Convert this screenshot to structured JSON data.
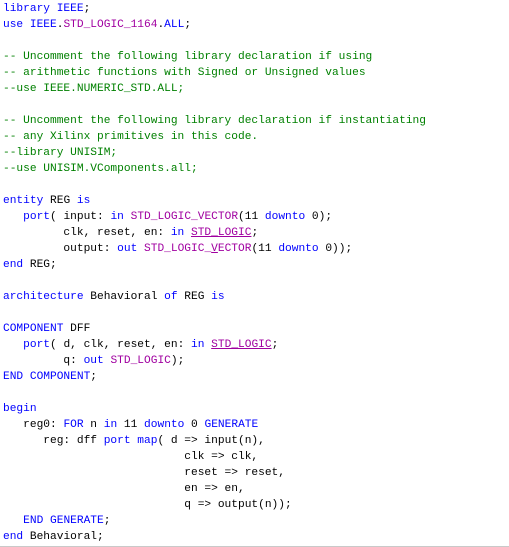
{
  "editor": {
    "colors": {
      "keyword": "#0000ff",
      "comment": "#008000",
      "type": "#a000a0",
      "text": "#000000",
      "background": "#ffffff"
    },
    "lines": [
      [
        [
          "kw",
          "library"
        ],
        [
          "tx",
          " "
        ],
        [
          "kw",
          "IEEE"
        ],
        [
          "tx",
          ";"
        ]
      ],
      [
        [
          "kw",
          "use"
        ],
        [
          "tx",
          " "
        ],
        [
          "kw",
          "IEEE"
        ],
        [
          "tx",
          "."
        ],
        [
          "ty",
          "STD_LOGIC_1164"
        ],
        [
          "tx",
          "."
        ],
        [
          "kw",
          "ALL"
        ],
        [
          "tx",
          ";"
        ]
      ],
      [],
      [
        [
          "cm",
          "-- Uncomment the following library declaration if using"
        ]
      ],
      [
        [
          "cm",
          "-- arithmetic functions with Signed or Unsigned values"
        ]
      ],
      [
        [
          "cm",
          "--use IEEE.NUMERIC_STD.ALL;"
        ]
      ],
      [],
      [
        [
          "cm",
          "-- Uncomment the following library declaration if instantiating"
        ]
      ],
      [
        [
          "cm",
          "-- any Xilinx primitives in this code."
        ]
      ],
      [
        [
          "cm",
          "--library UNISIM;"
        ]
      ],
      [
        [
          "cm",
          "--use UNISIM.VComponents.all;"
        ]
      ],
      [],
      [
        [
          "kw",
          "entity"
        ],
        [
          "tx",
          " REG "
        ],
        [
          "kw",
          "is"
        ]
      ],
      [
        [
          "tx",
          "   "
        ],
        [
          "kw",
          "port"
        ],
        [
          "tx",
          "( input: "
        ],
        [
          "kw",
          "in"
        ],
        [
          "tx",
          " "
        ],
        [
          "ty",
          "STD_LOGIC_VECTOR"
        ],
        [
          "tx",
          "(11 "
        ],
        [
          "kw",
          "downto"
        ],
        [
          "tx",
          " 0);"
        ]
      ],
      [
        [
          "tx",
          "         clk, reset, en: "
        ],
        [
          "kw",
          "in"
        ],
        [
          "tx",
          " "
        ],
        [
          "tyu",
          "STD_LOGIC"
        ],
        [
          "tx",
          ";"
        ]
      ],
      [
        [
          "tx",
          "         output: "
        ],
        [
          "kw",
          "out"
        ],
        [
          "tx",
          " "
        ],
        [
          "ty",
          "STD_LOGIC_"
        ],
        [
          "tyu",
          "V"
        ],
        [
          "ty",
          "ECTOR"
        ],
        [
          "tx",
          "(11 "
        ],
        [
          "kw",
          "downto"
        ],
        [
          "tx",
          " 0));"
        ]
      ],
      [
        [
          "kw",
          "end"
        ],
        [
          "tx",
          " REG;"
        ]
      ],
      [],
      [
        [
          "kw",
          "architecture"
        ],
        [
          "tx",
          " Behavioral "
        ],
        [
          "kw",
          "of"
        ],
        [
          "tx",
          " REG "
        ],
        [
          "kw",
          "is"
        ]
      ],
      [],
      [
        [
          "kw",
          "COMPONENT"
        ],
        [
          "tx",
          " DFF"
        ]
      ],
      [
        [
          "tx",
          "   "
        ],
        [
          "kw",
          "port"
        ],
        [
          "tx",
          "( d, clk, reset, en: "
        ],
        [
          "kw",
          "in"
        ],
        [
          "tx",
          " "
        ],
        [
          "tyu",
          "STD_LOGIC"
        ],
        [
          "tx",
          ";"
        ]
      ],
      [
        [
          "tx",
          "         q: "
        ],
        [
          "kw",
          "out"
        ],
        [
          "tx",
          " "
        ],
        [
          "ty",
          "STD_LOGIC"
        ],
        [
          "tx",
          ");"
        ]
      ],
      [
        [
          "kw",
          "END COMPONENT"
        ],
        [
          "tx",
          ";"
        ]
      ],
      [],
      [
        [
          "kw",
          "begin"
        ]
      ],
      [
        [
          "tx",
          "   reg0: "
        ],
        [
          "kw",
          "FOR"
        ],
        [
          "tx",
          " n "
        ],
        [
          "kw",
          "in"
        ],
        [
          "tx",
          " 11 "
        ],
        [
          "kw",
          "downto"
        ],
        [
          "tx",
          " 0 "
        ],
        [
          "kw",
          "GENERATE"
        ]
      ],
      [
        [
          "tx",
          "      reg: dff "
        ],
        [
          "kw",
          "port map"
        ],
        [
          "tx",
          "( d => input(n),"
        ]
      ],
      [
        [
          "tx",
          "                           clk => clk,"
        ]
      ],
      [
        [
          "tx",
          "                           reset => reset,"
        ]
      ],
      [
        [
          "tx",
          "                           en => en,"
        ]
      ],
      [
        [
          "tx",
          "                           q => output(n));"
        ]
      ],
      [
        [
          "tx",
          "   "
        ],
        [
          "kw",
          "END GENERATE"
        ],
        [
          "tx",
          ";"
        ]
      ],
      [
        [
          "kw",
          "end"
        ],
        [
          "tx",
          " Behavioral;"
        ]
      ]
    ]
  }
}
